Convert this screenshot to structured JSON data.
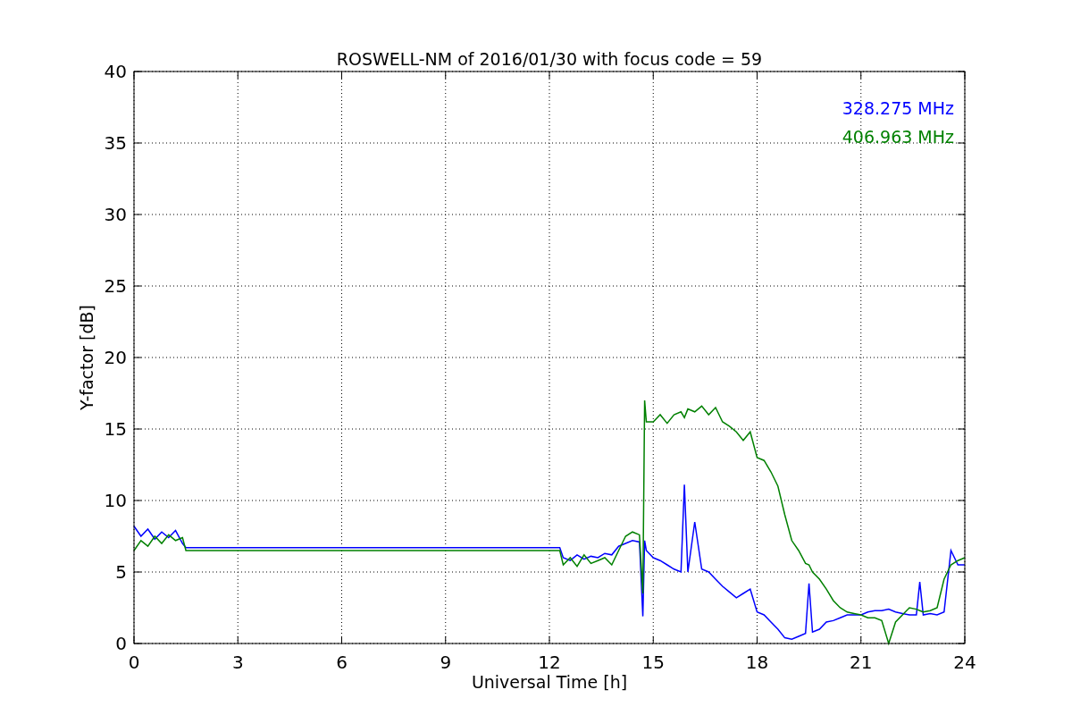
{
  "figure": {
    "chart_data": {
      "type": "line",
      "title": "ROSWELL-NM of 2016/01/30 with focus code = 59",
      "xlabel": "Universal Time [h]",
      "ylabel": "Y-factor [dB]",
      "x": [
        0,
        0.2,
        0.4,
        0.6,
        0.8,
        1,
        1.2,
        1.4,
        1.5,
        3,
        6,
        9,
        12,
        12.3,
        12.4,
        12.6,
        12.8,
        13,
        13.2,
        13.4,
        13.6,
        13.8,
        14,
        14.2,
        14.4,
        14.6,
        14.7,
        14.75,
        14.8,
        15,
        15.2,
        15.4,
        15.6,
        15.8,
        15.9,
        16,
        16.2,
        16.4,
        16.6,
        16.8,
        17,
        17.2,
        17.4,
        17.6,
        17.8,
        18,
        18.2,
        18.4,
        18.6,
        18.8,
        19,
        19.2,
        19.4,
        19.5,
        19.6,
        19.8,
        20,
        20.2,
        20.4,
        20.6,
        20.8,
        21,
        21.2,
        21.4,
        21.6,
        21.8,
        22,
        22.2,
        22.4,
        22.6,
        22.7,
        22.8,
        23,
        23.2,
        23.4,
        23.6,
        23.8,
        24
      ],
      "series": [
        {
          "name": "328.275 MHz",
          "color": "#0000ff",
          "values": [
            8.2,
            7.5,
            8,
            7.3,
            7.8,
            7.4,
            7.9,
            7,
            6.7,
            6.7,
            6.7,
            6.7,
            6.7,
            6.7,
            6,
            5.8,
            6.2,
            5.9,
            6.1,
            6,
            6.3,
            6.2,
            6.8,
            7,
            7.2,
            7.1,
            1.9,
            7.2,
            6.5,
            6,
            5.8,
            5.5,
            5.2,
            5,
            11.1,
            5,
            8.5,
            5.2,
            5,
            4.5,
            4,
            3.6,
            3.2,
            3.5,
            3.8,
            2.2,
            2,
            1.5,
            1,
            0.4,
            0.3,
            0.5,
            0.7,
            4.2,
            0.8,
            1,
            1.5,
            1.6,
            1.8,
            2,
            2,
            2,
            2.2,
            2.3,
            2.3,
            2.4,
            2.2,
            2.1,
            2,
            2,
            4.3,
            2,
            2.1,
            2,
            2.2,
            6.5,
            5.5,
            5.5
          ]
        },
        {
          "name": "406.963 MHz",
          "color": "#008000",
          "values": [
            6.5,
            7.2,
            6.8,
            7.5,
            7,
            7.6,
            7.2,
            7.4,
            6.5,
            6.5,
            6.5,
            6.5,
            6.5,
            6.5,
            5.5,
            6,
            5.4,
            6.2,
            5.6,
            5.8,
            6,
            5.5,
            6.5,
            7.5,
            7.8,
            7.6,
            3.5,
            17,
            15.5,
            15.5,
            16,
            15.4,
            16,
            16.2,
            15.8,
            16.4,
            16.2,
            16.6,
            16,
            16.5,
            15.5,
            15.2,
            14.8,
            14.2,
            14.8,
            13,
            12.8,
            12,
            11,
            9,
            7.2,
            6.5,
            5.6,
            5.5,
            5,
            4.5,
            3.8,
            3,
            2.5,
            2.2,
            2.1,
            2,
            1.8,
            1.8,
            1.6,
            0,
            1.5,
            2,
            2.5,
            2.4,
            2.3,
            2.2,
            2.3,
            2.5,
            4.5,
            5.5,
            5.8,
            6
          ]
        }
      ],
      "grid": true,
      "xlim": [
        0,
        24
      ],
      "ylim": [
        0,
        40
      ],
      "xticks": [
        0,
        3,
        6,
        9,
        12,
        15,
        18,
        21,
        24
      ],
      "yticks": [
        0,
        5,
        10,
        15,
        20,
        25,
        30,
        35,
        40
      ]
    }
  }
}
